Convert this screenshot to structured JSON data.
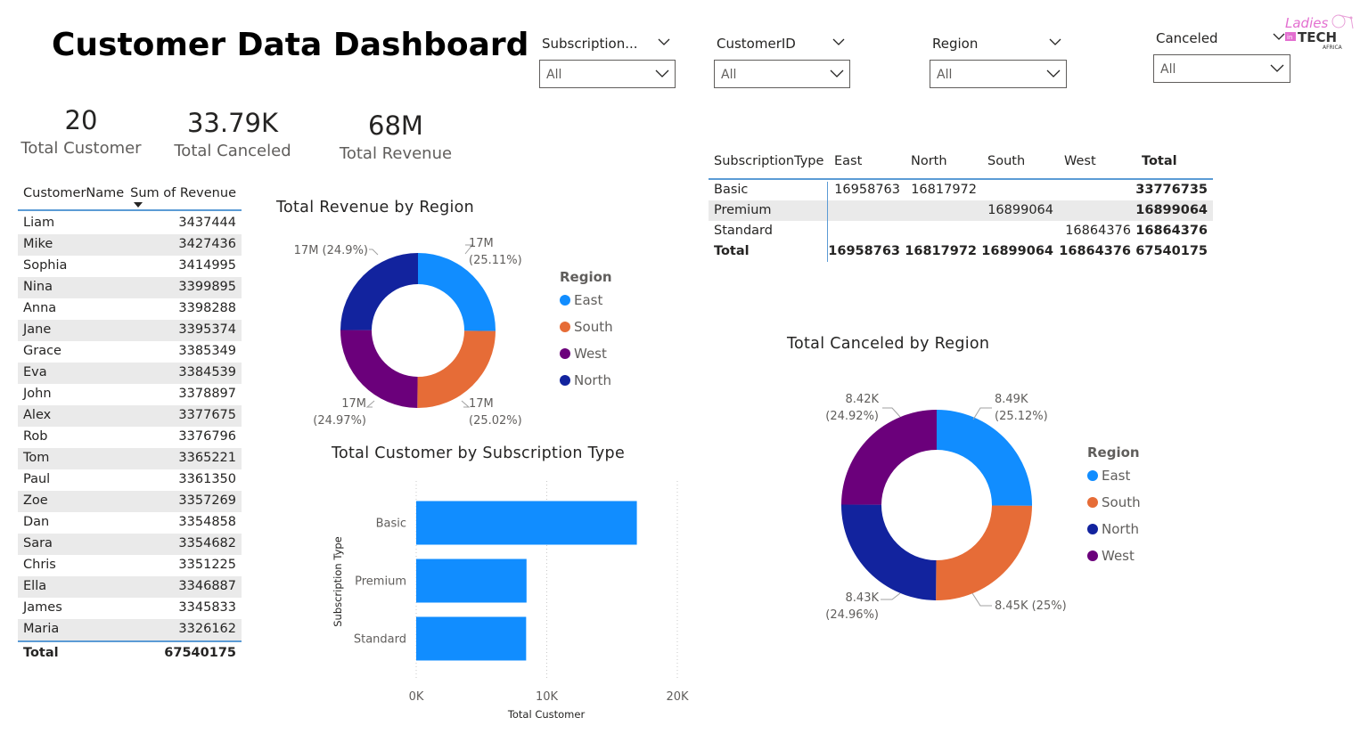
{
  "title": "Customer Data Dashboard",
  "logo": {
    "text_top": "Ladies",
    "text_mid": "in",
    "text_main": "TECH",
    "text_sub": "AFRICA"
  },
  "slicers": [
    {
      "label": "Subscription...",
      "value": "All"
    },
    {
      "label": "CustomerID",
      "value": "All"
    },
    {
      "label": "Region",
      "value": "All"
    },
    {
      "label": "Canceled",
      "value": "All"
    }
  ],
  "cards": [
    {
      "value": "20",
      "label": "Total Customer"
    },
    {
      "value": "33.79K",
      "label": "Total Canceled"
    },
    {
      "value": "68M",
      "label": "Total Revenue"
    }
  ],
  "customer_table": {
    "headers": [
      "CustomerName",
      "Sum of Revenue"
    ],
    "rows": [
      [
        "Liam",
        "3437444"
      ],
      [
        "Mike",
        "3427436"
      ],
      [
        "Sophia",
        "3414995"
      ],
      [
        "Nina",
        "3399895"
      ],
      [
        "Anna",
        "3398288"
      ],
      [
        "Jane",
        "3395374"
      ],
      [
        "Grace",
        "3385349"
      ],
      [
        "Eva",
        "3384539"
      ],
      [
        "John",
        "3378897"
      ],
      [
        "Alex",
        "3377675"
      ],
      [
        "Rob",
        "3376796"
      ],
      [
        "Tom",
        "3365221"
      ],
      [
        "Paul",
        "3361350"
      ],
      [
        "Zoe",
        "3357269"
      ],
      [
        "Dan",
        "3354858"
      ],
      [
        "Sara",
        "3354682"
      ],
      [
        "Chris",
        "3351225"
      ],
      [
        "Ella",
        "3346887"
      ],
      [
        "James",
        "3345833"
      ],
      [
        "Maria",
        "3326162"
      ]
    ],
    "total_label": "Total",
    "total_value": "67540175"
  },
  "matrix": {
    "headers": [
      "SubscriptionType",
      "East",
      "North",
      "South",
      "West",
      "Total"
    ],
    "rows": [
      [
        "Basic",
        "16958763",
        "16817972",
        "",
        "",
        "33776735"
      ],
      [
        "Premium",
        "",
        "",
        "16899064",
        "",
        "16899064"
      ],
      [
        "Standard",
        "",
        "",
        "",
        "16864376",
        "16864376"
      ]
    ],
    "total_row": [
      "Total",
      "16958763",
      "16817972",
      "16899064",
      "16864376",
      "67540175"
    ]
  },
  "colors": {
    "east": "#118dff",
    "south": "#e66c37",
    "west": "#6b007b",
    "north": "#12239e",
    "accent_line": "#5b9bd5"
  },
  "chart_data": [
    {
      "type": "pie",
      "title": "Total Revenue by Region",
      "legend_title": "Region",
      "legend_placement": "right",
      "slices": [
        {
          "name": "East",
          "value": 16958763,
          "label": "17M",
          "pct": "(25.11%)",
          "color": "#118dff"
        },
        {
          "name": "South",
          "value": 16899064,
          "label": "17M",
          "pct": "(25.02%)",
          "color": "#e66c37"
        },
        {
          "name": "West",
          "value": 16864376,
          "label": "17M",
          "pct": "(24.97%)",
          "color": "#6b007b"
        },
        {
          "name": "North",
          "value": 16817972,
          "label": "17M (24.9%)",
          "pct": "",
          "color": "#12239e"
        }
      ],
      "legend": [
        "East",
        "South",
        "West",
        "North"
      ]
    },
    {
      "type": "bar",
      "title": "Total Customer by Subscription Type",
      "categories": [
        "Basic",
        "Premium",
        "Standard"
      ],
      "values": [
        16900,
        8450,
        8420
      ],
      "xlabel": "Total Customer",
      "ylabel": "Subscription Type",
      "xlim": [
        0,
        20000
      ],
      "ticks": [
        "0K",
        "10K",
        "20K"
      ],
      "grid": true
    },
    {
      "type": "pie",
      "title": "Total Canceled by Region",
      "legend_title": "Region",
      "legend_placement": "right",
      "slices": [
        {
          "name": "East",
          "value": 8490,
          "label": "8.49K",
          "pct": "(25.12%)",
          "color": "#118dff"
        },
        {
          "name": "South",
          "value": 8450,
          "label": "8.45K (25%)",
          "pct": "",
          "color": "#e66c37"
        },
        {
          "name": "North",
          "value": 8430,
          "label": "8.43K",
          "pct": "(24.96%)",
          "color": "#12239e"
        },
        {
          "name": "West",
          "value": 8420,
          "label": "8.42K",
          "pct": "(24.92%)",
          "color": "#6b007b"
        }
      ],
      "legend": [
        "East",
        "South",
        "North",
        "West"
      ]
    }
  ]
}
